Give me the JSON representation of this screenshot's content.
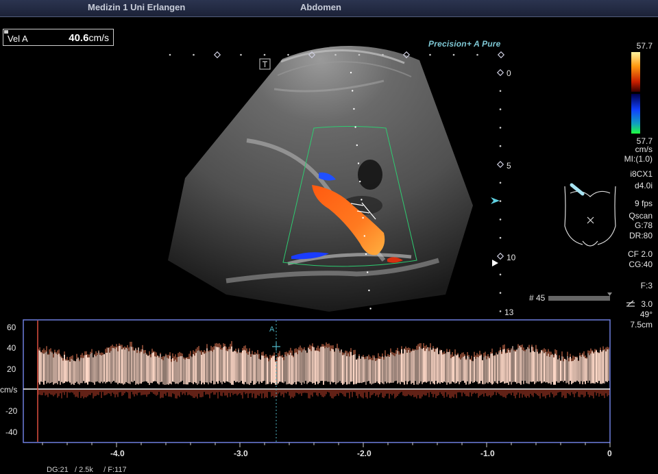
{
  "header": {
    "institution": "Medizin 1 Uni Erlangen",
    "preset": "Abdomen"
  },
  "measurement": {
    "label": "Vel A",
    "value": "40.6",
    "unit": "cm/s"
  },
  "brand": {
    "text": "Precision+ A Pure"
  },
  "colorbar": {
    "max_label": "57.7",
    "min_label": "57.7",
    "unit": "cm/s"
  },
  "params": {
    "mi": "MI:(1.0)",
    "probe": "i8CX1",
    "mode": "d4.0i",
    "fps": "9 fps",
    "qscan": "Qscan",
    "gain": "G:78",
    "dr": "DR:80",
    "cf": "CF 2.0",
    "cg": "CG:40",
    "filter": "F:3",
    "pw_freq": "3.0",
    "angle": "49°",
    "gate_depth": "7.5cm"
  },
  "cine": {
    "frame_label": "# 45",
    "position_fraction": 1.0
  },
  "depth_scale": {
    "labels": [
      "0",
      "5",
      "10",
      "13"
    ]
  },
  "spectrum": {
    "y_ticks": [
      "60",
      "40",
      "20",
      "-20",
      "-40"
    ],
    "y_unit": "cm/s",
    "x_ticks": [
      "-4.0",
      "-3.0",
      "-2.0",
      "-1.0",
      "0"
    ],
    "cursor_label": "A"
  },
  "footer": {
    "text": "DG:21   / 2.5k     / F:117"
  },
  "colors": {
    "panel_border": "#6f7fe0",
    "baseline": "#ffffff",
    "spectrum": "#ffd9c8"
  }
}
